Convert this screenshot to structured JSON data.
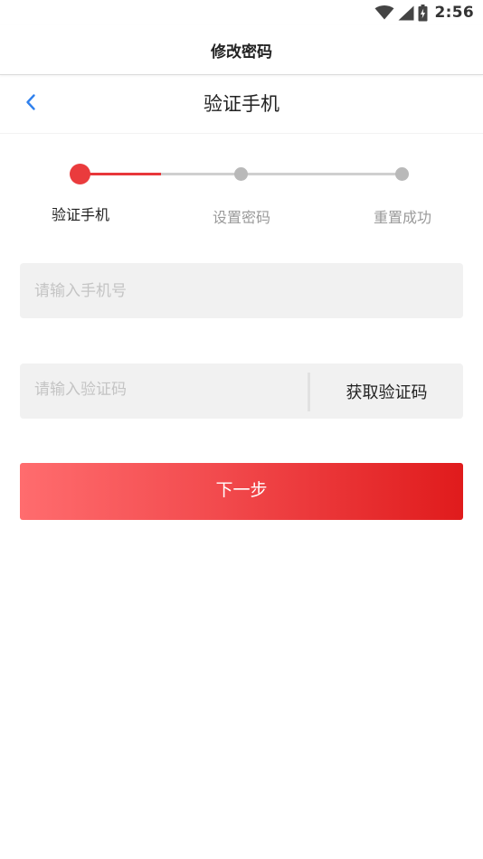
{
  "status_bar": {
    "time": "2:56",
    "icons": [
      "wifi-icon",
      "cellular-signal-icon",
      "battery-icon"
    ]
  },
  "app_bar": {
    "title": "修改密码"
  },
  "header": {
    "back_icon": "chevron-left-icon",
    "title": "验证手机"
  },
  "stepper": {
    "current_step": 1,
    "steps": [
      {
        "label": "验证手机",
        "state": "active"
      },
      {
        "label": "设置密码",
        "state": "inactive"
      },
      {
        "label": "重置成功",
        "state": "inactive"
      }
    ]
  },
  "form": {
    "phone_placeholder": "请输入手机号",
    "phone_value": "",
    "code_placeholder": "请输入验证码",
    "code_value": "",
    "get_code_label": "获取验证码",
    "next_label": "下一步"
  },
  "colors": {
    "accent": "#EA3B3D",
    "back_icon": "#2F80ED",
    "inactive_step": "#B9B9B9",
    "field_background": "#F1F1F1",
    "button_gradient_start": "#FF6C6E",
    "button_gradient_end": "#E01B1C"
  }
}
